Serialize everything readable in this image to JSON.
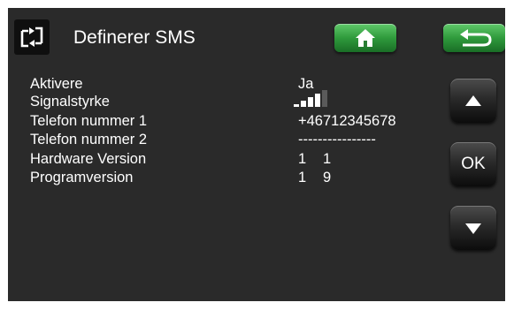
{
  "header": {
    "title": "Definerer SMS",
    "menu_icon": "swap-arrows-icon",
    "home_icon": "home-icon",
    "back_icon": "return-arrow-icon"
  },
  "rows": [
    {
      "label": "Aktivere",
      "value": "Ja"
    },
    {
      "label": "Signalstyrke",
      "signal_level": 4,
      "signal_max": 5
    },
    {
      "label": "Telefon nummer 1",
      "value": "+46712345678"
    },
    {
      "label": "Telefon nummer 2",
      "value": "----------------"
    },
    {
      "label": "Hardware Version",
      "value_a": "1",
      "value_b": "1"
    },
    {
      "label": "Programversion",
      "value_a": "1",
      "value_b": "9"
    }
  ],
  "nav": {
    "ok_label": "OK",
    "up_icon": "triangle-up-icon",
    "down_icon": "triangle-down-icon"
  },
  "colors": {
    "screen_background": "#2a2a2a",
    "text": "#ffffff",
    "green_button": "#2f9a3c",
    "nav_button": "#2a2a2a"
  }
}
